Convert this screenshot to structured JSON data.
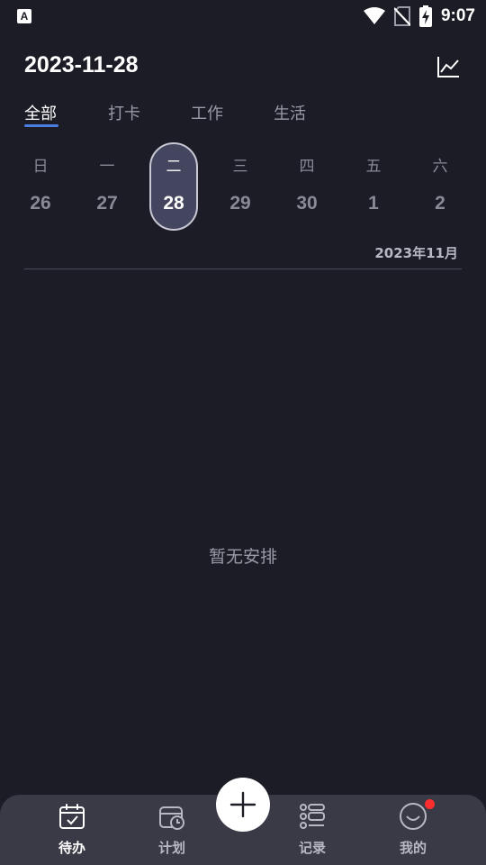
{
  "status_bar": {
    "app_badge": "A",
    "time": "9:07",
    "icons": [
      "wifi-icon",
      "no-sim-icon",
      "battery-charging-icon"
    ]
  },
  "header": {
    "date": "2023-11-28",
    "chart_icon": "line-chart-icon"
  },
  "tabs": [
    {
      "label": "全部",
      "active": true
    },
    {
      "label": "打卡",
      "active": false
    },
    {
      "label": "工作",
      "active": false
    },
    {
      "label": "生活",
      "active": false
    }
  ],
  "week": [
    {
      "weekday": "日",
      "day": "26",
      "selected": false
    },
    {
      "weekday": "一",
      "day": "27",
      "selected": false
    },
    {
      "weekday": "二",
      "day": "28",
      "selected": true
    },
    {
      "weekday": "三",
      "day": "29",
      "selected": false
    },
    {
      "weekday": "四",
      "day": "30",
      "selected": false
    },
    {
      "weekday": "五",
      "day": "1",
      "selected": false
    },
    {
      "weekday": "六",
      "day": "2",
      "selected": false
    }
  ],
  "month_label": "2023年11月",
  "empty_text": "暂无安排",
  "bottom_nav": [
    {
      "label": "待办",
      "icon": "todo-calendar-icon",
      "active": true
    },
    {
      "label": "计划",
      "icon": "plan-clock-icon",
      "active": false
    },
    {
      "label": "记录",
      "icon": "record-list-icon",
      "active": false
    },
    {
      "label": "我的",
      "icon": "smile-profile-icon",
      "active": false
    }
  ],
  "add_button_icon": "plus-icon",
  "colors": {
    "background": "#1c1c26",
    "accent": "#4a7ee0",
    "selected_day_bg": "#44455f",
    "nav_bg": "#3a3a46",
    "notification": "#ff2d2d"
  }
}
